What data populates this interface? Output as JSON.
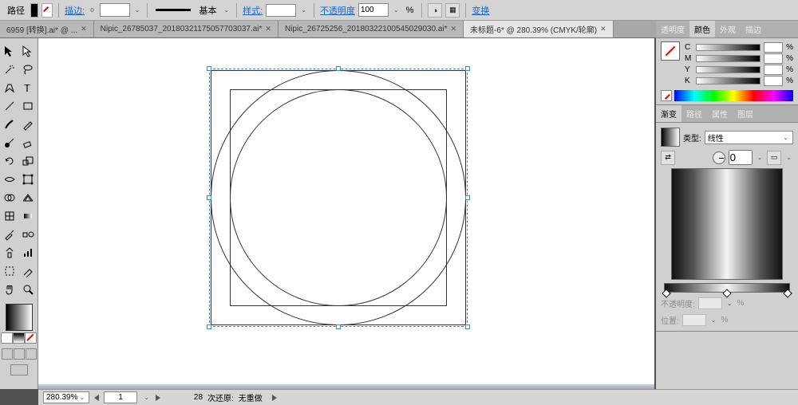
{
  "options": {
    "path_label": "路径",
    "stroke_label": "描边:",
    "stroke_pt": "",
    "basic_label": "基本",
    "style_label": "样式:",
    "opacity_label": "不透明度",
    "opacity_val": "100",
    "transform_label": "变换"
  },
  "tabs": [
    {
      "label": "6959 [转换].ai* @ ..."
    },
    {
      "label": "Nipic_26785037_20180321175057703037.ai* "
    },
    {
      "label": "Nipic_26725256_20180322100545029030.ai* "
    },
    {
      "label": "未标题-6* @ 280.39% (CMYK/轮廓) "
    }
  ],
  "active_tab": 3,
  "right": {
    "color_tabs": [
      "透明度",
      "颜色",
      "外观",
      "描边"
    ],
    "color_active": 1,
    "channels": [
      "C",
      "M",
      "Y",
      "K"
    ],
    "pct_suffix": "%",
    "grad_tabs": [
      "渐变",
      "路径",
      "属性",
      "图层"
    ],
    "grad_active": 0,
    "type_lbl": "类型:",
    "type_val": "线性",
    "angle_val": "0",
    "opacity_lbl": "不透明度:",
    "pos_lbl": "位置:"
  },
  "status": {
    "zoom": "280.39%",
    "artboard": "1",
    "undo_count": "28",
    "undo_lbl": "次还原:",
    "undo_state": "无重做"
  }
}
